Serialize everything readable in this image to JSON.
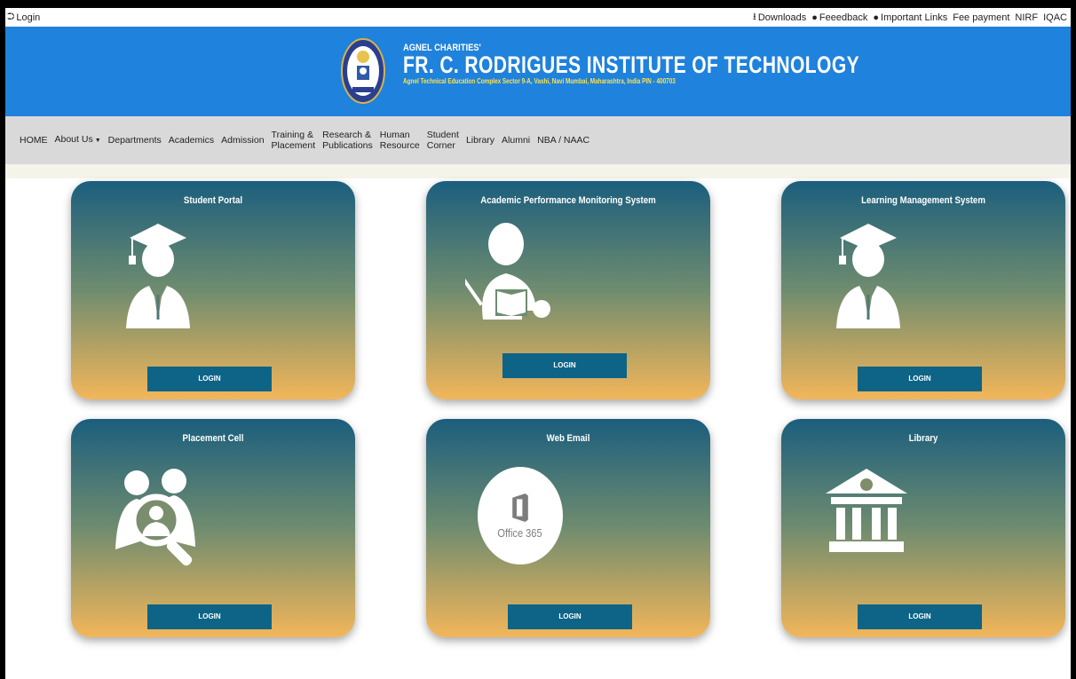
{
  "topbar": {
    "login_label": "Login",
    "links": {
      "downloads": "Downloads",
      "feedback": "Feeedback",
      "important": "Important Links",
      "fee": "Fee payment",
      "nirf": "NIRF",
      "iqac": "IQAC"
    }
  },
  "header": {
    "org_small": "AGNEL CHARITIES'",
    "title": "FR. C. RODRIGUES INSTITUTE OF TECHNOLOGY",
    "address": "Agnel Technical Education Complex Sector 9-A, Vashi, Navi Mumbai, Maharashtra, India PIN - 400703",
    "bg_color": "#1f82dc"
  },
  "nav": {
    "home": "HOME",
    "about": "About Us",
    "departments": "Departments",
    "academics": "Academics",
    "admission": "Admission",
    "training_1": "Training &",
    "training_2": "Placement",
    "research_1": "Research &",
    "research_2": "Publications",
    "human_1": "Human",
    "human_2": "Resource",
    "student_1": "Student",
    "student_2": "Corner",
    "library": "Library",
    "alumni": "Alumni",
    "nba": "NBA / NAAC"
  },
  "cards": [
    {
      "title": "Student Portal",
      "button": "LOGIN",
      "icon": "graduate-icon"
    },
    {
      "title": "Academic Performance Monitoring System",
      "button": "LOGIN",
      "icon": "teacher-icon"
    },
    {
      "title": "Learning Management System",
      "button": "LOGIN",
      "icon": "graduate-icon"
    },
    {
      "title": "Placement Cell",
      "button": "LOGIN",
      "icon": "people-search-icon"
    },
    {
      "title": "Web Email",
      "button": "LOGIN",
      "icon": "office365-icon",
      "icon_text": "Office 365"
    },
    {
      "title": "Library",
      "button": "LOGIN",
      "icon": "library-building-icon"
    }
  ]
}
